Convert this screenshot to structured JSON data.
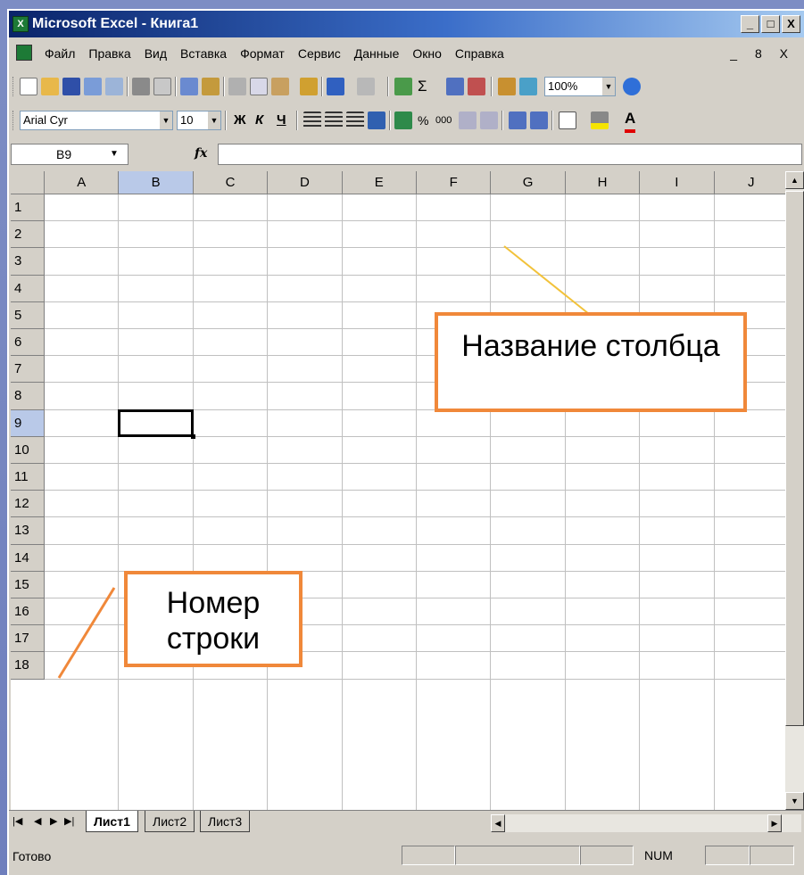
{
  "window": {
    "title": "Microsoft Excel - Книга1",
    "controls": [
      "_",
      "□",
      "X"
    ]
  },
  "menu": {
    "items": [
      "Файл",
      "Правка",
      "Вид",
      "Вставка",
      "Формат",
      "Сервис",
      "Данные",
      "Окно",
      "Справка"
    ],
    "controls": "_ 8 X"
  },
  "toolbar_standard": {
    "zoom": "100%"
  },
  "toolbar_format": {
    "font": "Arial Cyr",
    "size": "10",
    "bold": "Ж",
    "italic": "К",
    "underline": "Ч",
    "percent": "%",
    "thousands": "000"
  },
  "formula_bar": {
    "name_box": "B9",
    "fx": "fx",
    "value": ""
  },
  "grid": {
    "columns": [
      "A",
      "B",
      "C",
      "D",
      "E",
      "F",
      "G",
      "H",
      "I",
      "J"
    ],
    "rows": [
      "1",
      "2",
      "3",
      "4",
      "5",
      "6",
      "7",
      "8",
      "9",
      "10",
      "11",
      "12",
      "13",
      "14",
      "15",
      "16",
      "17",
      "18"
    ],
    "selected_cell": "B9"
  },
  "sheets": {
    "tabs": [
      "Лист1",
      "Лист2",
      "Лист3"
    ],
    "active": "Лист1"
  },
  "status": {
    "text": "Готово",
    "num": "NUM"
  },
  "callouts": {
    "column_name": "Название столбца",
    "row_number": "Номер строки"
  },
  "colors": {
    "callout_border": "#f0883a",
    "pointer_line_column": "#f2c23a",
    "pointer_line_row": "#f0883a",
    "selected_header": "#b9c9e8"
  }
}
